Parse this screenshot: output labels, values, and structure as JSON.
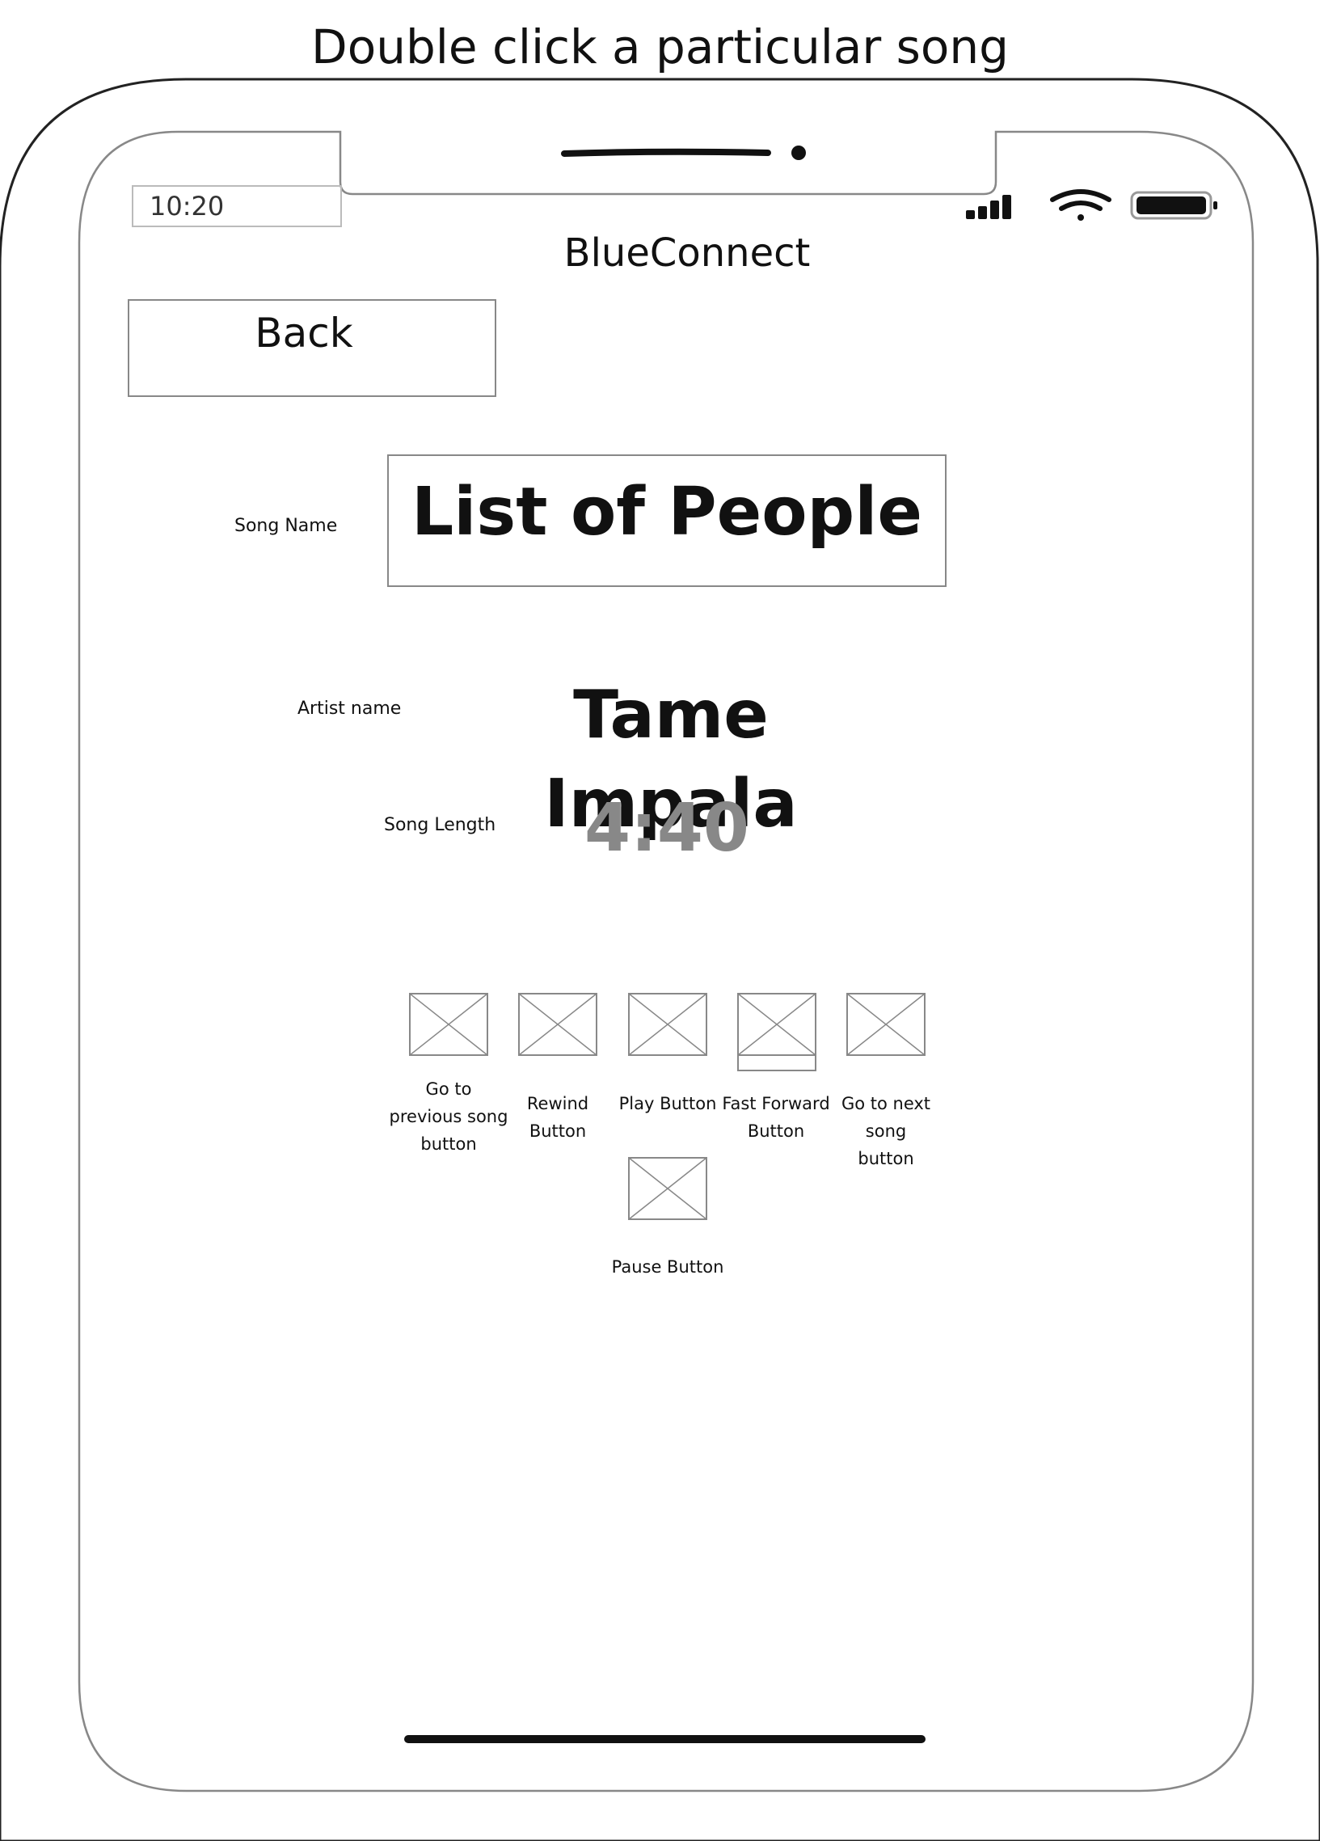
{
  "caption": "Double click a particular song",
  "status_bar": {
    "time": "10:20"
  },
  "app": {
    "title": "BlueConnect"
  },
  "back_button": {
    "label": "Back"
  },
  "song": {
    "name_label": "Song Name",
    "name_value": "List of People",
    "artist_label": "Artist name",
    "artist_value": "Tame Impala",
    "length_label": "Song Length",
    "length_value": "4:40"
  },
  "controls": {
    "previous": "Go to previous song button",
    "rewind": "Rewind Button",
    "play": "Play Button",
    "fast_forward": "Fast Forward Button",
    "next": "Go to next song button",
    "pause": "Pause Button"
  },
  "colors": {
    "song_length": "#888888",
    "outline": "#888888",
    "text": "#111111"
  }
}
